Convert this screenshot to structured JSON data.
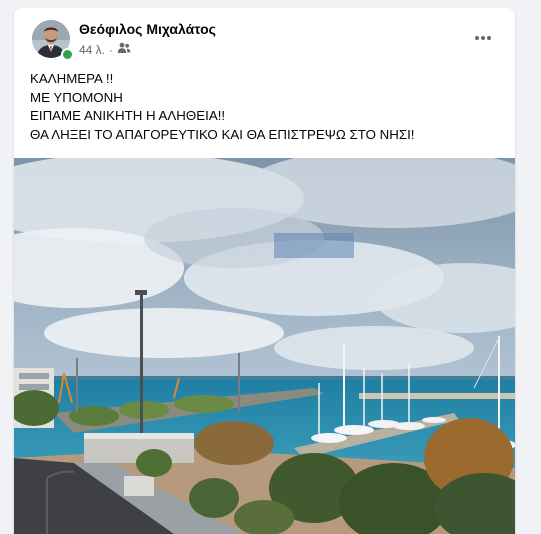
{
  "post": {
    "author": "Θεόφιλος Μιχαλάτος",
    "time": "44 λ.",
    "audience_icon": "friends-icon",
    "more_icon": "more-options-icon",
    "lines": [
      "ΚΑΛΗΜΕΡΑ !!",
      "ΜΕ ΥΠΟΜΟΝΗ",
      "ΕΙΠΑΜΕ ΑΝΙΚΗΤΗ Η ΑΛΗΘΕΙΑ!!",
      "ΘΑ ΛΗΞΕΙ ΤΟ ΑΠΑΓΟΡΕΥΤΙΚΟ ΚΑΙ ΘΑ ΕΠΙΣΤΡΕΨΩ ΣΤΟ ΝΗΣΙ!"
    ]
  },
  "colors": {
    "online": "#31a24c",
    "secondary_text": "#65676b",
    "primary_text": "#050505"
  }
}
